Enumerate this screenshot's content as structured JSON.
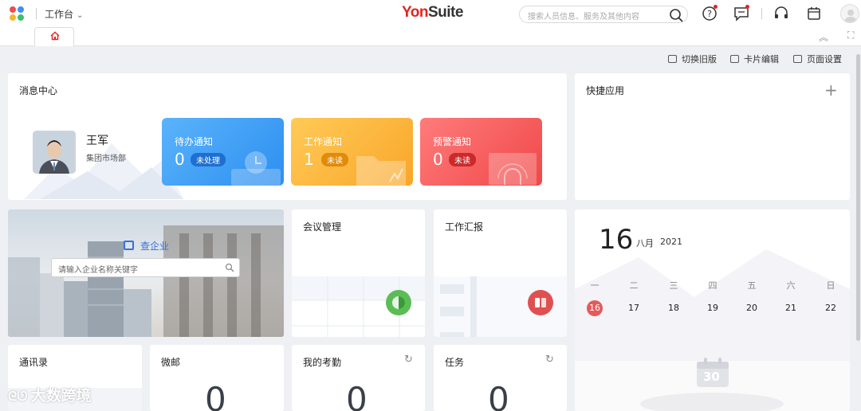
{
  "topbar": {
    "workspace": "工作台",
    "brand_yon": "Yon",
    "brand_suite": "Suite",
    "search_placeholder": "搜索人员信息、服务及其他内容"
  },
  "toolbar": {
    "switch_old": "切换旧版",
    "card_edit": "卡片编辑",
    "page_settings": "页面设置"
  },
  "message_center": {
    "title": "消息中心",
    "user_name": "王军",
    "user_dept": "集团市场部",
    "cards": [
      {
        "label": "待办通知",
        "count": "0",
        "badge": "未处理"
      },
      {
        "label": "工作通知",
        "count": "1",
        "badge": "未读"
      },
      {
        "label": "预警通知",
        "count": "0",
        "badge": "未读"
      }
    ]
  },
  "quick_apps": {
    "title": "快捷应用"
  },
  "enterprise": {
    "link": "查企业",
    "placeholder": "请输入企业名称关键字"
  },
  "meeting": {
    "title": "会议管理"
  },
  "report": {
    "title": "工作汇报"
  },
  "calendar": {
    "day": "16",
    "month": "八月",
    "year": "2021",
    "weekdays": [
      "一",
      "二",
      "三",
      "四",
      "五",
      "六",
      "日"
    ],
    "dates": [
      "16",
      "17",
      "18",
      "19",
      "20",
      "21",
      "22"
    ],
    "icon_number": "30"
  },
  "contacts": {
    "title": "通讯录"
  },
  "micromail": {
    "title": "微邮",
    "value": "0"
  },
  "attendance": {
    "title": "我的考勤",
    "value": "0"
  },
  "tasks": {
    "title": "任务",
    "value": "0"
  },
  "watermark": "大数跨境",
  "colors": {
    "todo": "#3d9bf2",
    "work": "#fbb033",
    "warn": "#f5545a",
    "brand_red": "#e4231f"
  }
}
